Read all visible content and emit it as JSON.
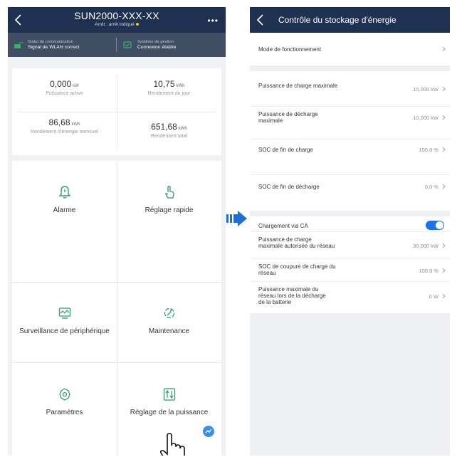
{
  "left_screen": {
    "header": {
      "title": "SUN2000-XXX-XX",
      "subtitle": "Arrêt : arrêt indiqué"
    },
    "status_bar": {
      "communication": {
        "label": "Statut de communication",
        "value": "Signal de WLAN correct"
      },
      "management": {
        "label": "Système de gestion",
        "value": "Connexion établie"
      }
    },
    "stats": [
      {
        "value": "0,000",
        "unit": "kW",
        "caption": "Puissance active"
      },
      {
        "value": "10,75",
        "unit": "kWh",
        "caption": "Rendement du jour"
      },
      {
        "value": "86,68",
        "unit": "kWh",
        "caption": "Rendement d'énergie mensuel"
      },
      {
        "value": "651,68",
        "unit": "kWh",
        "caption": "Rendement total"
      }
    ],
    "tiles": [
      {
        "label": "Alarme",
        "icon": "bell-icon"
      },
      {
        "label": "Réglage rapide",
        "icon": "tap-hand-icon"
      },
      {
        "label": "Surveillance de périphérique",
        "icon": "monitor-icon"
      },
      {
        "label": "Maintenance",
        "icon": "wrench-icon"
      },
      {
        "label": "Paramètres",
        "icon": "gear-icon"
      },
      {
        "label": "Réglage de la puissance",
        "icon": "sliders-icon"
      }
    ]
  },
  "right_screen": {
    "header": {
      "title": "Contrôle du stockage d'énergie"
    },
    "section1": [
      {
        "label": "Mode de fonctionnement",
        "value": ""
      }
    ],
    "section2": [
      {
        "label": "Puissance de charge maximale",
        "value": "10,000 kW"
      },
      {
        "label": "Puissance de décharge maximale",
        "value": "10,000 kW"
      },
      {
        "label": "SOC de fin de charge",
        "value": "100,0 %"
      },
      {
        "label": "SOC de fin de décharge",
        "value": "0,0 %"
      }
    ],
    "section3": {
      "toggle_row": {
        "label": "Chargement via CA",
        "enabled": true
      },
      "rows": [
        {
          "label": "Puissance de charge maximale autorisée du réseau",
          "value": "30,000 kW"
        },
        {
          "label": "SOC de coupure de charge du réseau",
          "value": "100,0 %"
        },
        {
          "label": "Puissance maximale du réseau lors de la décharge de la batterie",
          "value": "0 W"
        }
      ]
    }
  },
  "colors": {
    "header_navy": "#1f3151",
    "status_gray": "#3f4e63",
    "accent_blue": "#1a73e8",
    "icon_green": "#2e9e6a",
    "arrow_blue": "#1f6fd1"
  }
}
